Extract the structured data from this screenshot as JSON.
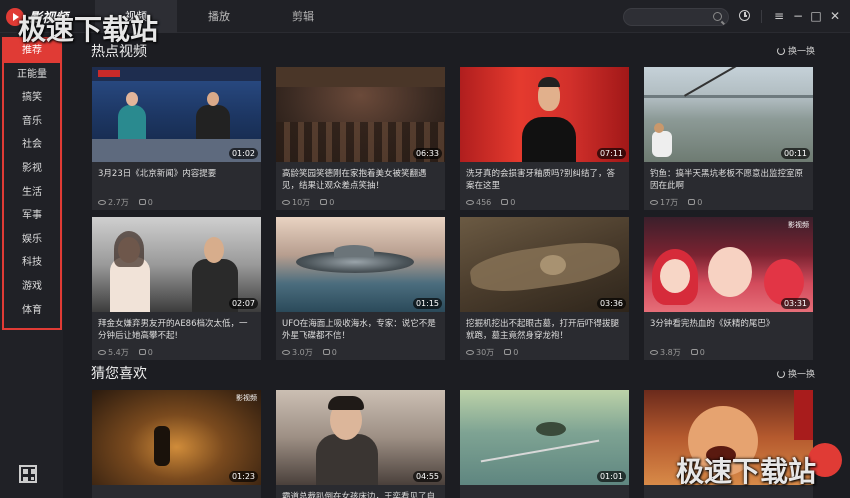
{
  "app": {
    "name": "影视频",
    "logo_alt": ""
  },
  "tabs": [
    {
      "label": "视频"
    },
    {
      "label": "播放"
    },
    {
      "label": "剪辑"
    }
  ],
  "search": {
    "placeholder": "",
    "value": ""
  },
  "window_controls": [
    "history-icon",
    "menu-icon",
    "minimize-icon",
    "maximize-icon",
    "close-icon"
  ],
  "sidebar": {
    "categories": [
      "推荐",
      "正能量",
      "搞笑",
      "音乐",
      "社会",
      "影视",
      "生活",
      "军事",
      "娱乐",
      "科技",
      "游戏",
      "体育"
    ],
    "active_index": 0
  },
  "sections": {
    "hot": {
      "title": "热点视频",
      "refresh": "换一换"
    },
    "guess": {
      "title": "猜您喜欢",
      "refresh": "换一换"
    }
  },
  "hot_videos": [
    {
      "title": "3月23日《北京新闻》内容提要",
      "duration": "01:02",
      "views": "2.7万",
      "comments": "0"
    },
    {
      "title": "高龄笑园笑德刚在家抱着美女被笑翻遇见，结果让观众差点笑抽！",
      "duration": "06:33",
      "views": "10万",
      "comments": "0"
    },
    {
      "title": "洗牙真的会损害牙釉质吗?别纠结了，答案在这里",
      "duration": "07:11",
      "views": "456",
      "comments": "0"
    },
    {
      "title": "钓鱼：搞半天黑坑老板不愿意出监控室原因在此啊",
      "duration": "00:11",
      "views": "17万",
      "comments": "0"
    },
    {
      "title": "拜金女嫌弃男友开的AE86档次太低，一分钟后让她高攀不起!",
      "duration": "02:07",
      "views": "5.4万",
      "comments": "0"
    },
    {
      "title": "UFO在海面上吸收海水，专家：说它不是外星飞碟都不信！",
      "duration": "01:15",
      "views": "3.0万",
      "comments": "0"
    },
    {
      "title": "挖掘机挖出不起眼古墓，打开后吓得拔腿就跑，墓主竟然身穿龙袍！",
      "duration": "03:36",
      "views": "30万",
      "comments": "0"
    },
    {
      "title": "3分钟看完热血的《妖精的尾巴》",
      "duration": "03:31",
      "views": "3.8万",
      "comments": "0"
    }
  ],
  "guess_videos": [
    {
      "title": "",
      "duration": "01:23"
    },
    {
      "title": "霸道总裁趴倒在女孩床边，王奕看见了自己",
      "duration": "04:55"
    },
    {
      "title": "",
      "duration": "01:01"
    },
    {
      "title": "",
      "duration": ""
    }
  ],
  "watermark": {
    "top": "极速下载站",
    "bottom": "极速下载站",
    "overlay_badge": "影视频"
  },
  "colors": {
    "accent": "#e03b35",
    "bg": "#1c1d22",
    "card": "#2a2b30"
  }
}
